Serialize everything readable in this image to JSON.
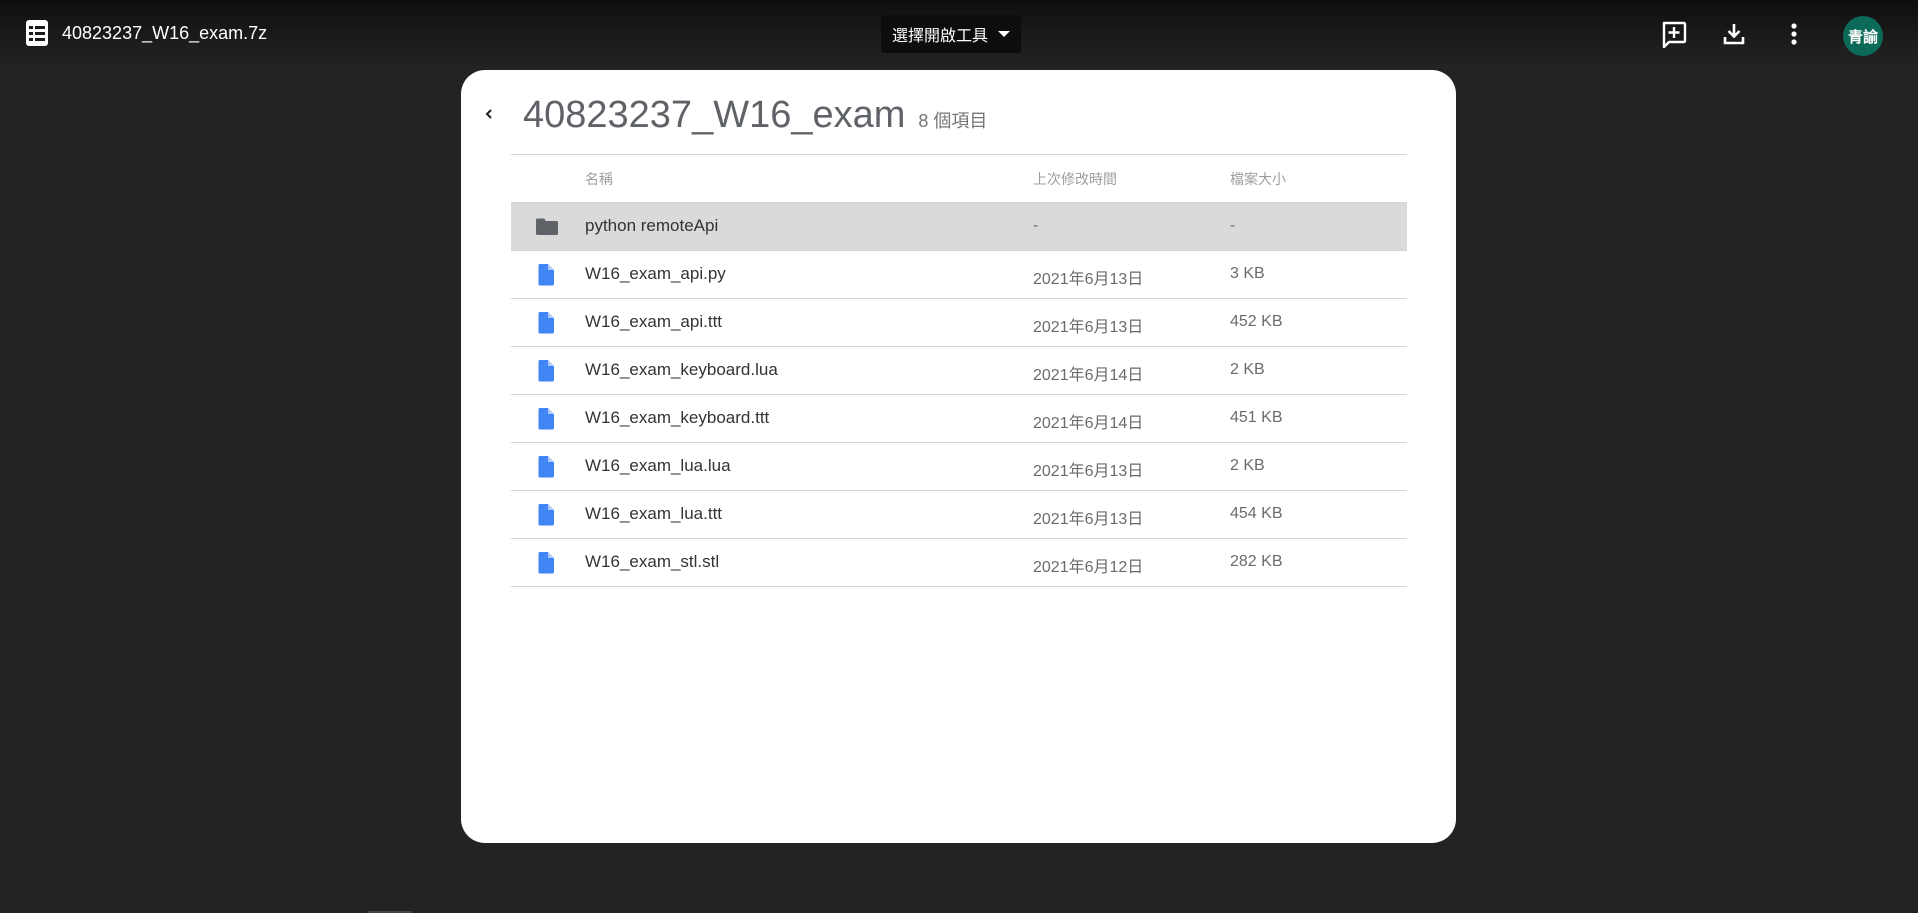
{
  "header": {
    "file_title": "40823237_W16_exam.7z",
    "open_with_label": "選擇開啟工具",
    "avatar_text": "青諭",
    "icons": [
      "doc-list-icon",
      "add-to-drive-icon",
      "download-icon",
      "more-vert-icon",
      "chevron-down-icon"
    ]
  },
  "colors": {
    "background": "#232323",
    "panel": "#ffffff",
    "selected_row": "#dadada",
    "file_icon_blue": "#4285f4",
    "folder_icon_gray": "#5f6368",
    "avatar": "#0c6a58"
  },
  "folder": {
    "name": "40823237_W16_exam",
    "item_count": "8 個項目"
  },
  "table": {
    "columns": {
      "name": "名稱",
      "modified": "上次修改時間",
      "size": "檔案大小"
    },
    "rows": [
      {
        "name": "python remoteApi",
        "modified": "-",
        "size": "-",
        "icon": "folder-icon",
        "selected": true
      },
      {
        "name": "W16_exam_api.py",
        "modified": "2021年6月13日",
        "size": "3 KB",
        "icon": "file-icon"
      },
      {
        "name": "W16_exam_api.ttt",
        "modified": "2021年6月13日",
        "size": "452 KB",
        "icon": "file-icon"
      },
      {
        "name": "W16_exam_keyboard.lua",
        "modified": "2021年6月14日",
        "size": "2 KB",
        "icon": "file-icon"
      },
      {
        "name": "W16_exam_keyboard.ttt",
        "modified": "2021年6月14日",
        "size": "451 KB",
        "icon": "file-icon"
      },
      {
        "name": "W16_exam_lua.lua",
        "modified": "2021年6月13日",
        "size": "2 KB",
        "icon": "file-icon"
      },
      {
        "name": "W16_exam_lua.ttt",
        "modified": "2021年6月13日",
        "size": "454 KB",
        "icon": "file-icon"
      },
      {
        "name": "W16_exam_stl.stl",
        "modified": "2021年6月12日",
        "size": "282 KB",
        "icon": "file-icon"
      }
    ]
  }
}
